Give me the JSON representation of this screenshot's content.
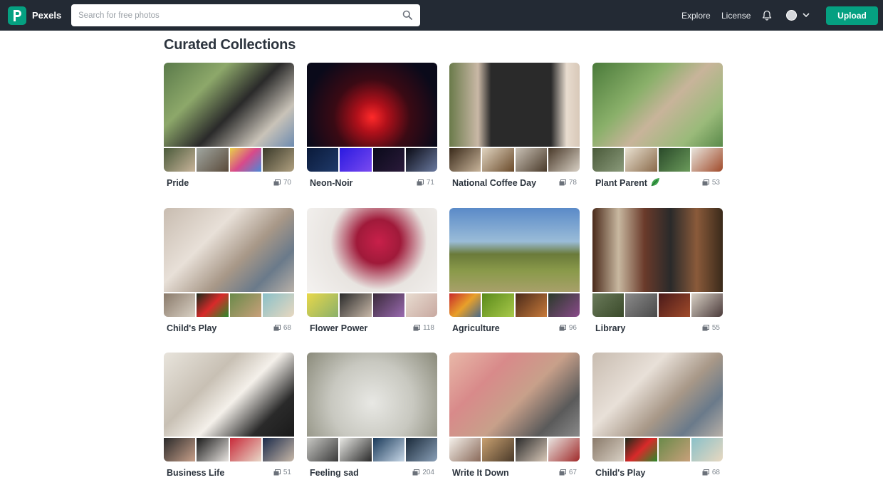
{
  "header": {
    "brand": "Pexels",
    "search_placeholder": "Search for free photos",
    "nav": [
      "Explore",
      "License"
    ],
    "upload_label": "Upload",
    "accent": "#05a081",
    "background": "#232a34"
  },
  "page": {
    "title": "Curated Collections"
  },
  "collections": [
    {
      "title": "Pride",
      "count": "70",
      "main": "linear-gradient(135deg,#5a7a4a 0%,#8da86a 30%,#2a2a2a 55%,#c9c3b8 80%,#6d8bb0 100%)",
      "thumbs": [
        "linear-gradient(135deg,#4a5a3a,#c8b49a)",
        "linear-gradient(135deg,#a0a6a0,#5a4a3a)",
        "linear-gradient(135deg,#e8d04a,#d84a8a,#4a8ad8)",
        "linear-gradient(135deg,#3a3a2a,#b0a080)"
      ]
    },
    {
      "title": "Neon-Noir",
      "count": "71",
      "main": "radial-gradient(circle at 50% 65%,#ff2a2a 0%,#b0101a 18%,#3a0a14 45%,#0a0a1a 80%)",
      "thumbs": [
        "linear-gradient(135deg,#0a1a3a,#203a6a)",
        "linear-gradient(135deg,#2a1ae0,#7a4af0)",
        "linear-gradient(135deg,#0a0a1a,#2a1a3a)",
        "linear-gradient(135deg,#0a0a14,#6a7aa0)"
      ]
    },
    {
      "title": "National Coffee Day",
      "count": "78",
      "main": "linear-gradient(90deg,#6a7a4a 0%,#c9b8a6 22%,#2a2a2a 32%,#2a2a2a 78%,#e8dccf 90%,#d8c8b8 100%)",
      "thumbs": [
        "linear-gradient(135deg,#3a2a1a,#c8b49a)",
        "linear-gradient(135deg,#e0d4c0,#6a4a2a)",
        "linear-gradient(135deg,#c8c0b4,#4a3a2a)",
        "linear-gradient(135deg,#4a3a2a,#d8d0c4)"
      ]
    },
    {
      "title": "Plant Parent",
      "count": "53",
      "main": "linear-gradient(135deg,#4a7a3a 0%,#8ab06a 35%,#c8b49a 55%,#9aba7a 80%,#5a8a4a 100%)",
      "thumbs": [
        "linear-gradient(135deg,#4a5a3a,#8a9a7a)",
        "linear-gradient(135deg,#e8e0d0,#8a6a4a)",
        "linear-gradient(135deg,#2a4a2a,#6a9a5a)",
        "linear-gradient(135deg,#e8e4dc,#a04a2a)"
      ]
    },
    {
      "title": "Child's Play",
      "count": "68",
      "main": "linear-gradient(135deg,#c8bcb0 0%,#e8e0d8 35%,#a89888 60%,#6a7a8a 80%,#b8b0a8 100%)",
      "thumbs": [
        "linear-gradient(135deg,#8a7a6a,#d8d0c4)",
        "linear-gradient(135deg,#1a2a1a,#d82a2a,#2a8a2a)",
        "linear-gradient(135deg,#6a8a4a,#c8a07a)",
        "linear-gradient(135deg,#8ac0c8,#e8d8c0)"
      ]
    },
    {
      "title": "Flower Power",
      "count": "118",
      "main": "radial-gradient(circle at 55% 40%,#c8204a 0%,#a01a3a 25%,#e8e4e0 55%,#f4f2f0 100%)",
      "thumbs": [
        "linear-gradient(135deg,#e8d84a,#8ab06a)",
        "linear-gradient(135deg,#2a2a2a,#c8b8a8)",
        "linear-gradient(135deg,#3a2a3a,#9a6ab0)",
        "linear-gradient(135deg,#e8dcd0,#c8a8a0)"
      ]
    },
    {
      "title": "Agriculture",
      "count": "96",
      "main": "linear-gradient(180deg,#5a8ac8 0%,#9abcd8 40%,#6a7a3a 55%,#8a9a4a 75%,#a8a06a 100%)",
      "thumbs": [
        "linear-gradient(135deg,#c82a2a,#e8a02a,#4a6a8a)",
        "linear-gradient(135deg,#5a8a1a,#a8c84a)",
        "linear-gradient(135deg,#4a2a1a,#c87a3a)",
        "linear-gradient(135deg,#2a3a2a,#8a4a8a)"
      ]
    },
    {
      "title": "Library",
      "count": "55",
      "main": "linear-gradient(90deg,#4a2a1a 0%,#c8b8a0 20%,#6a3a2a 40%,#2a2a2a 60%,#8a5a3a 80%,#3a2a1a 100%)",
      "thumbs": [
        "linear-gradient(135deg,#6a7a5a,#3a4a2a)",
        "linear-gradient(135deg,#8a8a8a,#4a4a4a)",
        "linear-gradient(135deg,#4a1a1a,#a04a2a)",
        "linear-gradient(135deg,#d8d0c4,#4a3a3a)"
      ]
    },
    {
      "title": "Business Life",
      "count": "51",
      "main": "linear-gradient(135deg,#e8e4dc 0%,#c8c0b4 35%,#f4f0ea 55%,#2a2a2a 80%,#1a1a1a 100%)",
      "thumbs": [
        "linear-gradient(135deg,#2a2a2a,#c8a08a)",
        "linear-gradient(135deg,#1a1a1a,#e8e4e0)",
        "linear-gradient(135deg,#c82a3a,#e8d8c8)",
        "linear-gradient(135deg,#1a2a4a,#c8b8a8)"
      ]
    },
    {
      "title": "Feeling sad",
      "count": "204",
      "main": "radial-gradient(circle at 50% 60%,#e8e8e4 0%,#c8c8c0 50%,#8a8a7a 100%)",
      "thumbs": [
        "linear-gradient(135deg,#c8c8c4,#3a3a3a)",
        "linear-gradient(135deg,#e8e8e4,#2a2a2a)",
        "linear-gradient(135deg,#1a3a5a,#c8d8e8)",
        "linear-gradient(135deg,#1a2a3a,#8aa0b8)"
      ]
    },
    {
      "title": "Write It Down",
      "count": "67",
      "main": "linear-gradient(135deg,#e8b8a8 0%,#d88a8a 30%,#c8a08a 55%,#5a5a5a 80%,#8a8a8a 100%)",
      "thumbs": [
        "linear-gradient(135deg,#f4f0ea,#8a6a5a)",
        "linear-gradient(135deg,#c8a070,#4a3a2a)",
        "linear-gradient(135deg,#2a2a2a,#d8c8b8)",
        "linear-gradient(135deg,#e8e4e0,#a02a2a)"
      ]
    },
    {
      "title": "Child's Play",
      "count": "68",
      "main": "linear-gradient(135deg,#c8bcb0 0%,#e8e0d8 35%,#a89888 60%,#6a7a8a 80%,#b8b0a8 100%)",
      "thumbs": [
        "linear-gradient(135deg,#8a7a6a,#d8d0c4)",
        "linear-gradient(135deg,#1a2a1a,#d82a2a,#2a8a2a)",
        "linear-gradient(135deg,#6a8a4a,#c8a07a)",
        "linear-gradient(135deg,#8ac0c8,#e8d8c0)"
      ]
    }
  ]
}
